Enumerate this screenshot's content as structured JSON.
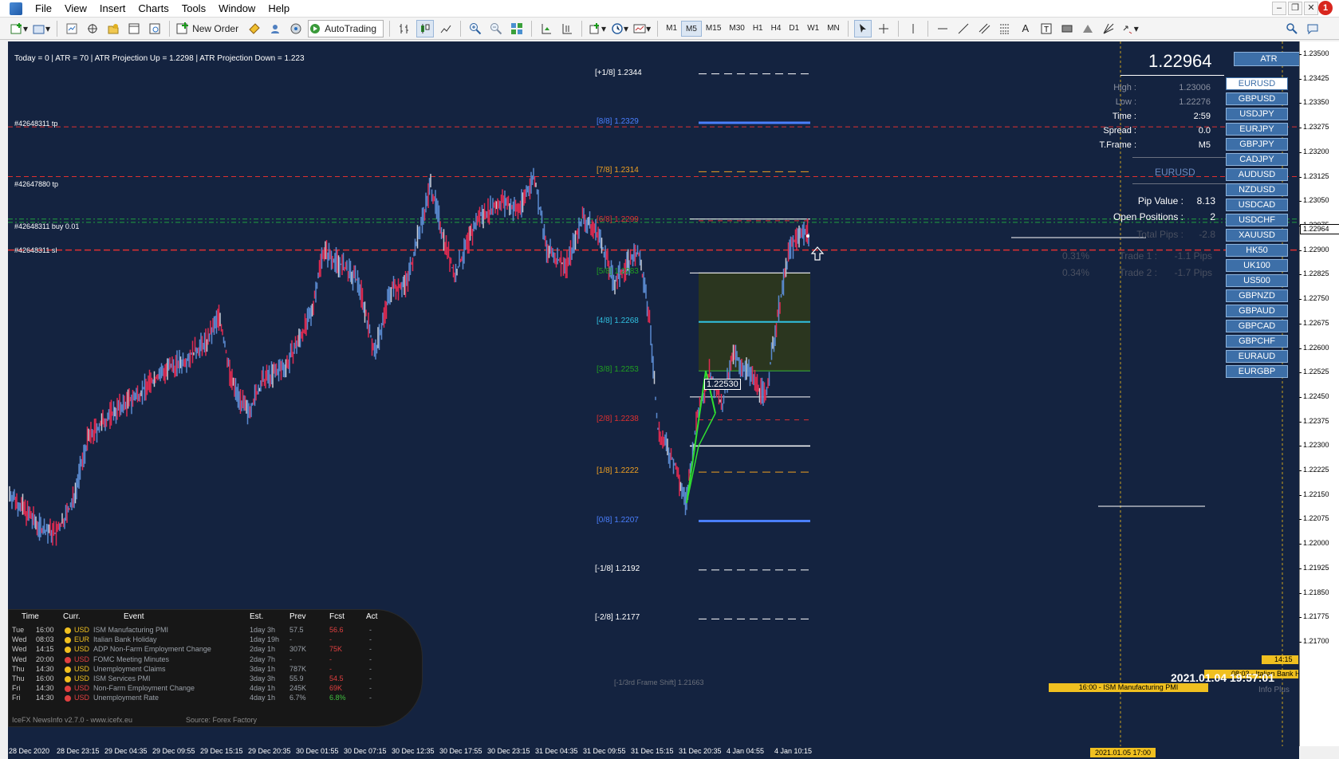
{
  "menu": {
    "items": [
      "File",
      "View",
      "Insert",
      "Charts",
      "Tools",
      "Window",
      "Help"
    ],
    "notification_count": "1"
  },
  "toolbar": {
    "new_order_label": "New Order",
    "autotrading_label": "AutoTrading",
    "timeframes": [
      "M1",
      "M5",
      "M15",
      "M30",
      "H1",
      "H4",
      "D1",
      "W1",
      "MN"
    ],
    "active_timeframe": "M5"
  },
  "chart": {
    "info_line": "Today = 0   |   ATR = 70   |   ATR Projection Up = 1.2298   |   ATR Projection Down = 1.223",
    "order_tags": {
      "tp1": "#42648311 tp",
      "tp2": "#42647880 tp",
      "buy": "#42648311 buy 0.01",
      "sl": "#42648311 sl"
    },
    "murrey_levels": [
      {
        "label": "[+1/8]",
        "value": "1.2344",
        "color": "#ffffff",
        "price": 1.2344
      },
      {
        "label": "[8/8]",
        "value": "1.2329",
        "color": "#4a7fff",
        "price": 1.2329
      },
      {
        "label": "[7/8]",
        "value": "1.2314",
        "color": "#f0a020",
        "price": 1.2314
      },
      {
        "label": "[6/8]",
        "value": "1.2299",
        "color": "#e03030",
        "price": 1.2299
      },
      {
        "label": "[5/8]",
        "value": "1.2283",
        "color": "#20a020",
        "price": 1.2283
      },
      {
        "label": "[4/8]",
        "value": "1.2268",
        "color": "#30c0e0",
        "price": 1.2268
      },
      {
        "label": "[3/8]",
        "value": "1.2253",
        "color": "#20a020",
        "price": 1.2253
      },
      {
        "label": "[2/8]",
        "value": "1.2238",
        "color": "#e03030",
        "price": 1.2238
      },
      {
        "label": "[1/8]",
        "value": "1.2222",
        "color": "#f0a020",
        "price": 1.2222
      },
      {
        "label": "[0/8]",
        "value": "1.2207",
        "color": "#4a7fff",
        "price": 1.2207
      },
      {
        "label": "[-1/8]",
        "value": "1.2192",
        "color": "#ffffff",
        "price": 1.2192
      },
      {
        "label": "[-2/8]",
        "value": "1.2177",
        "color": "#ffffff",
        "price": 1.2177
      }
    ],
    "frame_shift_label": "[-1/3rd Frame Shift]  1.21663",
    "price_box": "1.22530",
    "price_labels": [
      "1.23500",
      "1.23425",
      "1.23350",
      "1.23275",
      "1.23200",
      "1.23125",
      "1.23050",
      "1.22975",
      "1.22900",
      "1.22825",
      "1.22750",
      "1.22675",
      "1.22600",
      "1.22525",
      "1.22450",
      "1.22375",
      "1.22300",
      "1.22225",
      "1.22150",
      "1.22075",
      "1.22000",
      "1.21925",
      "1.21850",
      "1.21775",
      "1.21700"
    ],
    "current_price": "1.22964",
    "time_labels": [
      "28 Dec 2020",
      "28 Dec 23:15",
      "29 Dec 04:35",
      "29 Dec 09:55",
      "29 Dec 15:15",
      "29 Dec 20:35",
      "30 Dec 01:55",
      "30 Dec 07:15",
      "30 Dec 12:35",
      "30 Dec 17:55",
      "30 Dec 23:15",
      "31 Dec 04:35",
      "31 Dec 09:55",
      "31 Dec 15:15",
      "31 Dec 20:35",
      "4 Jan 04:55",
      "4 Jan 10:15"
    ]
  },
  "panel": {
    "big_price": "1.22964",
    "atr_button": "ATR",
    "high_label": "High :",
    "high_value": "1.23006",
    "low_label": "Low :",
    "low_value": "1.22276",
    "time_label": "Time :",
    "time_value": "2:59",
    "spread_label": "Spread :",
    "spread_value": "0.0",
    "tframe_label": "T.Frame :",
    "tframe_value": "M5",
    "symbol": "EURUSD",
    "pip_label": "Pip Value :",
    "pip_value": "8.13",
    "open_label": "Open Positions :",
    "open_value": "2",
    "total_label": "Total Pips :",
    "total_value": "-2.8",
    "trade1_pct": "0.31%",
    "trade1_label": "Trade 1 :",
    "trade1_value": "-1.1 Pips",
    "trade2_pct": "0.34%",
    "trade2_label": "Trade 2 :",
    "trade2_value": "-1.7 Pips",
    "symbols": [
      "EURUSD",
      "GBPUSD",
      "USDJPY",
      "EURJPY",
      "GBPJPY",
      "CADJPY",
      "AUDUSD",
      "NZDUSD",
      "USDCAD",
      "USDCHF",
      "XAUUSD",
      "HK50",
      "UK100",
      "US500",
      "GBPNZD",
      "GBPAUD",
      "GBPCAD",
      "GBPCHF",
      "EURAUD",
      "EURGBP"
    ],
    "selected_symbol": "EURUSD"
  },
  "news": {
    "headers": [
      "Time",
      "Curr.",
      "Event",
      "Est.",
      "Prev",
      "Fcst",
      "Act"
    ],
    "rows": [
      {
        "day": "Tue",
        "time": "16:00",
        "curr": "USD",
        "event": "ISM Manufacturing PMI",
        "est": "1day 3h",
        "prev": "57.5",
        "fcst": "56.6",
        "act": "-",
        "dot": "#f0c020",
        "fcst_color": "#e04040"
      },
      {
        "day": "Wed",
        "time": "08:03",
        "curr": "EUR",
        "event": "Italian Bank Holiday",
        "est": "1day 19h",
        "prev": "-",
        "fcst": "-",
        "act": "-",
        "dot": "#f0c020",
        "fcst_color": "#e04040"
      },
      {
        "day": "Wed",
        "time": "14:15",
        "curr": "USD",
        "event": "ADP Non-Farm Employment Change",
        "est": "2day 1h",
        "prev": "307K",
        "fcst": "75K",
        "act": "-",
        "dot": "#f0c020",
        "fcst_color": "#e04040"
      },
      {
        "day": "Wed",
        "time": "20:00",
        "curr": "USD",
        "event": "FOMC Meeting Minutes",
        "est": "2day 7h",
        "prev": "-",
        "fcst": "-",
        "act": "-",
        "dot": "#e04040",
        "fcst_color": "#e04040"
      },
      {
        "day": "Thu",
        "time": "14:30",
        "curr": "USD",
        "event": "Unemployment Claims",
        "est": "3day 1h",
        "prev": "787K",
        "fcst": "-",
        "act": "-",
        "dot": "#f0c020",
        "fcst_color": "#e04040"
      },
      {
        "day": "Thu",
        "time": "16:00",
        "curr": "USD",
        "event": "ISM Services PMI",
        "est": "3day 3h",
        "prev": "55.9",
        "fcst": "54.5",
        "act": "-",
        "dot": "#f0c020",
        "fcst_color": "#e04040"
      },
      {
        "day": "Fri",
        "time": "14:30",
        "curr": "USD",
        "event": "Non-Farm Employment Change",
        "est": "4day 1h",
        "prev": "245K",
        "fcst": "69K",
        "act": "-",
        "dot": "#e04040",
        "fcst_color": "#e04040"
      },
      {
        "day": "Fri",
        "time": "14:30",
        "curr": "USD",
        "event": "Unemployment Rate",
        "est": "4day 1h",
        "prev": "6.7%",
        "fcst": "6.8%",
        "act": "-",
        "dot": "#e04040",
        "fcst_color": "#40c040"
      }
    ],
    "footer_left": "IceFX NewsInfo v2.7.0  -  www.icefx.eu",
    "footer_right": "Source: Forex Factory"
  },
  "bottom": {
    "event_ism": "16:00 - ISM Manufacturing PMI",
    "event_italian": "08:03 - Italian Bank H",
    "time_1415": "14:15",
    "date_label": "2021.01.05 17:00",
    "big_date": "2021.01.04 19:57:01",
    "info_plus": "Info Plus"
  }
}
